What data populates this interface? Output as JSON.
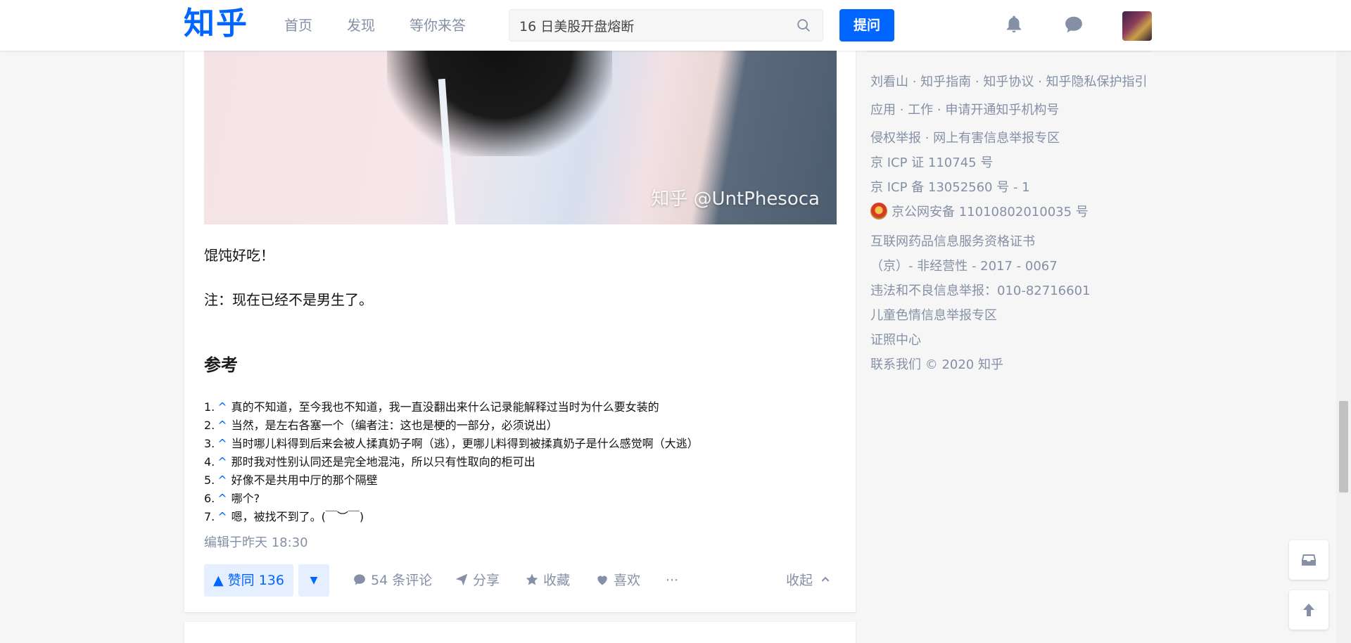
{
  "header": {
    "logo": "知乎",
    "nav": [
      "首页",
      "发现",
      "等你来答"
    ],
    "search_value": "16 日美股开盘熔断",
    "ask_label": "提问",
    "icons": [
      "bell-icon",
      "chat-icon"
    ]
  },
  "answer": {
    "photo_watermark": "知乎 @UntPhesoca",
    "para1": "馄饨好吃！",
    "para2": "注：现在已经不是男生了。",
    "ref_heading": "参考",
    "refs": [
      "真的不知道，至今我也不知道，我一直没翻出来什么记录能解释过当时为什么要女装的",
      "当然，是左右各塞一个（编者注：这也是梗的一部分，必须说出）",
      "当时哪儿料得到后来会被人揉真奶子啊（逃），更哪儿料得到被揉真奶子是什么感觉啊（大逃）",
      "那时我对性别认同还是完全地混沌，所以只有性取向的柜可出",
      "好像不是共用中厅的那个隔壁",
      "哪个?",
      "嗯，被找不到了。(￣︶￣)"
    ],
    "edited": "编辑于昨天 18:30",
    "actions": {
      "upvote": "▲ 赞同 136",
      "downvote": "▼",
      "comments": "54 条评论",
      "share": "分享",
      "collect": "收藏",
      "like": "喜欢",
      "more": "···",
      "collapse": "收起"
    }
  },
  "sidebar_footer": {
    "row1": [
      "刘看山",
      "知乎指南",
      "知乎协议",
      "知乎隐私保护指引"
    ],
    "row2": [
      "应用",
      "工作",
      "申请开通知乎机构号"
    ],
    "row3": [
      "侵权举报",
      "网上有害信息举报专区"
    ],
    "icp1": "京 ICP 证 110745 号",
    "icp2": "京 ICP 备 13052560 号 - 1",
    "police": "京公网安备 11010802010035 号",
    "drug1": "互联网药品信息服务资格证书",
    "drug2": "（京）- 非经营性 - 2017 - 0067",
    "report": "违法和不良信息举报：010-82716601",
    "child": "儿童色情信息举报专区",
    "license": "证照中心",
    "contact": "联系我们 © 2020 知乎"
  },
  "colors": {
    "brand": "#0066ff",
    "muted": "#8590a6",
    "upvote_bg": "#e5efff"
  }
}
